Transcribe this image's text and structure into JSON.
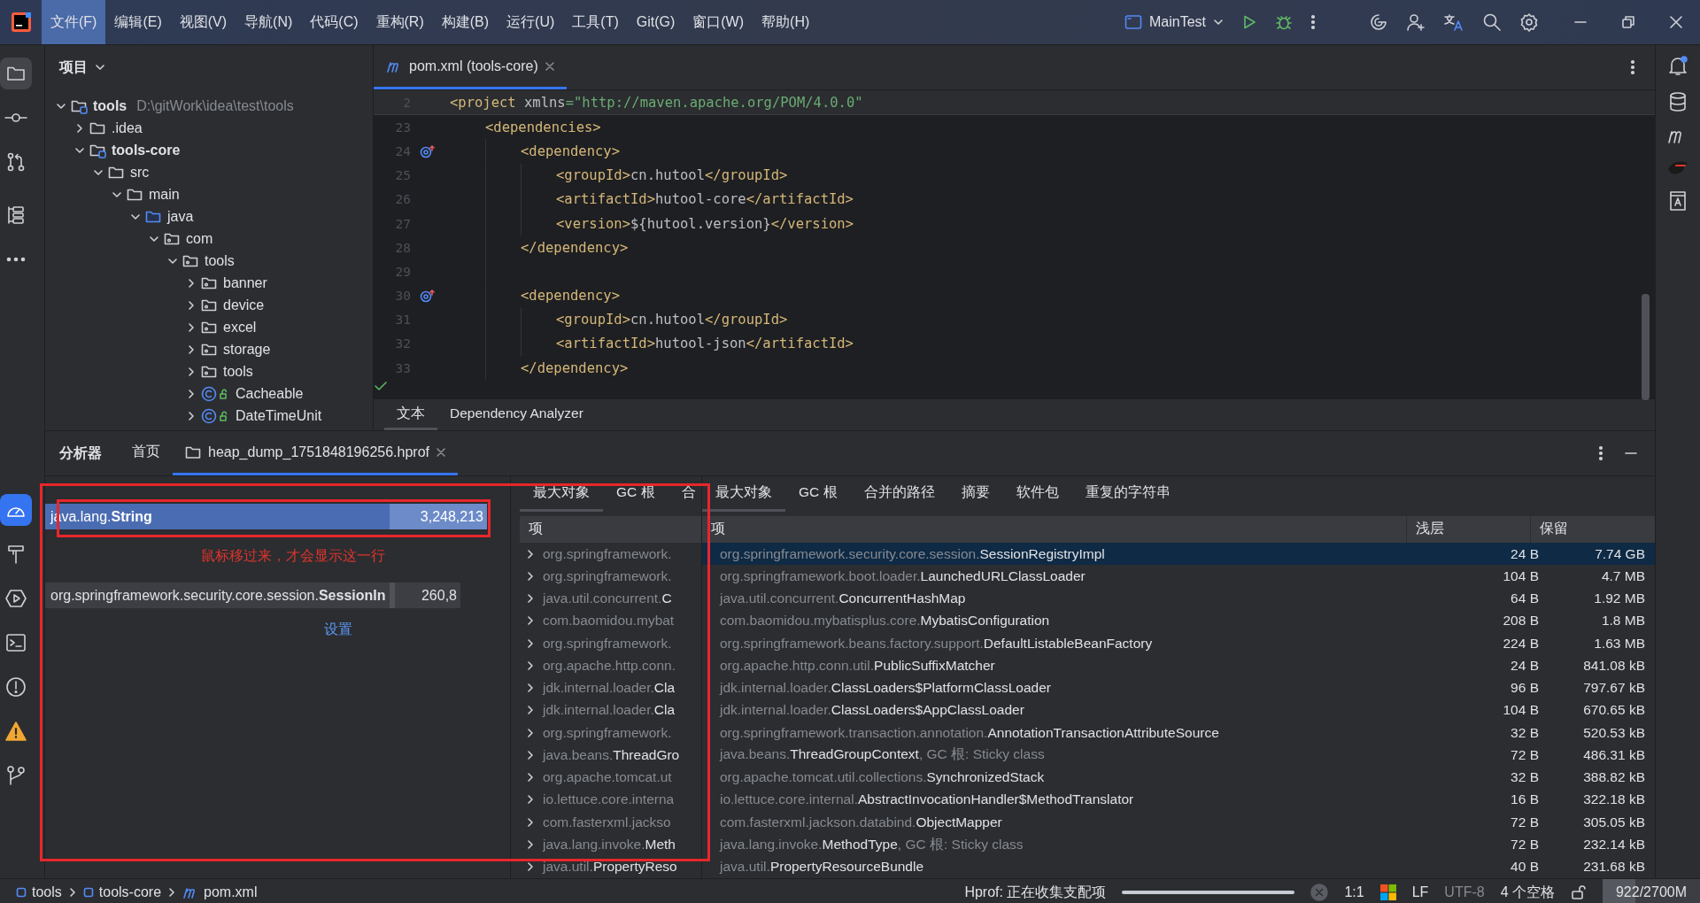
{
  "menu": [
    {
      "label": "文件(F)",
      "selected": true
    },
    {
      "label": "编辑(E)",
      "selected": false
    },
    {
      "label": "视图(V)",
      "selected": false
    },
    {
      "label": "导航(N)",
      "selected": false
    },
    {
      "label": "代码(C)",
      "selected": false
    },
    {
      "label": "重构(R)",
      "selected": false
    },
    {
      "label": "构建(B)",
      "selected": false
    },
    {
      "label": "运行(U)",
      "selected": false
    },
    {
      "label": "工具(T)",
      "selected": false
    },
    {
      "label": "Git(G)",
      "selected": false
    },
    {
      "label": "窗口(W)",
      "selected": false
    },
    {
      "label": "帮助(H)",
      "selected": false
    }
  ],
  "run_config": {
    "label": "MainTest"
  },
  "project_panel": {
    "title": "项目",
    "tree": [
      {
        "label": "tools",
        "kind": "module",
        "path": "D:\\gitWork\\idea\\test\\tools",
        "expanded": true,
        "children": [
          {
            "label": ".idea",
            "kind": "folder",
            "expanded": false
          },
          {
            "label": "tools-core",
            "kind": "module",
            "expanded": true,
            "children": [
              {
                "label": "src",
                "kind": "folder",
                "expanded": true,
                "children": [
                  {
                    "label": "main",
                    "kind": "folder",
                    "expanded": true,
                    "children": [
                      {
                        "label": "java",
                        "kind": "source",
                        "expanded": true,
                        "children": [
                          {
                            "label": "com",
                            "kind": "package",
                            "expanded": true,
                            "children": [
                              {
                                "label": "tools",
                                "kind": "package",
                                "expanded": true,
                                "children": [
                                  {
                                    "label": "banner",
                                    "kind": "package",
                                    "expanded": false
                                  },
                                  {
                                    "label": "device",
                                    "kind": "package",
                                    "expanded": false
                                  },
                                  {
                                    "label": "excel",
                                    "kind": "package",
                                    "expanded": false
                                  },
                                  {
                                    "label": "storage",
                                    "kind": "package",
                                    "expanded": false
                                  },
                                  {
                                    "label": "tools",
                                    "kind": "package",
                                    "expanded": false
                                  },
                                  {
                                    "label": "Cacheable",
                                    "kind": "class",
                                    "expanded": false
                                  },
                                  {
                                    "label": "DateTimeUnit",
                                    "kind": "class",
                                    "expanded": false
                                  }
                                ]
                              }
                            ]
                          }
                        ]
                      }
                    ]
                  }
                ]
              }
            ]
          }
        ]
      }
    ]
  },
  "editor": {
    "tab": {
      "label": "pom.xml (tools-core)",
      "selected": true
    },
    "lines": [
      {
        "n": "2",
        "sticky": true,
        "marker": false,
        "segs": [
          {
            "kind": "tag",
            "text": "<project"
          },
          {
            "kind": "text",
            "text": " xmlns"
          },
          {
            "kind": "string",
            "text": "=\"http://maven.apache.org/POM/4.0.0\""
          }
        ],
        "children": [
          {
            "n": "23",
            "sticky": false,
            "marker": false,
            "segs": [
              {
                "kind": "tag",
                "text": "<dependencies>"
              }
            ],
            "children": [
              {
                "n": "24",
                "sticky": false,
                "marker": true,
                "segs": [
                  {
                    "kind": "tag",
                    "text": "<dependency>"
                  }
                ],
                "children": [
                  {
                    "n": "25",
                    "sticky": false,
                    "marker": false,
                    "segs": [
                      {
                        "kind": "tag",
                        "text": "<groupId>"
                      },
                      {
                        "kind": "text",
                        "text": "cn.hutool"
                      },
                      {
                        "kind": "tag",
                        "text": "</groupId>"
                      }
                    ]
                  },
                  {
                    "n": "26",
                    "sticky": false,
                    "marker": false,
                    "segs": [
                      {
                        "kind": "tag",
                        "text": "<artifactId>"
                      },
                      {
                        "kind": "text",
                        "text": "hutool-core"
                      },
                      {
                        "kind": "tag",
                        "text": "</artifactId>"
                      }
                    ]
                  },
                  {
                    "n": "27",
                    "sticky": false,
                    "marker": false,
                    "segs": [
                      {
                        "kind": "tag",
                        "text": "<version>"
                      },
                      {
                        "kind": "text",
                        "text": "${hutool.version}"
                      },
                      {
                        "kind": "tag",
                        "text": "</version>"
                      }
                    ]
                  }
                ]
              },
              {
                "n": "28",
                "sticky": false,
                "marker": false,
                "segs": [
                  {
                    "kind": "tag",
                    "text": "</dependency>"
                  }
                ]
              },
              {
                "n": "29",
                "sticky": false,
                "marker": false
              },
              {
                "n": "30",
                "sticky": false,
                "marker": true,
                "segs": [
                  {
                    "kind": "tag",
                    "text": "<dependency>"
                  }
                ],
                "children": [
                  {
                    "n": "31",
                    "sticky": false,
                    "marker": false,
                    "segs": [
                      {
                        "kind": "tag",
                        "text": "<groupId>"
                      },
                      {
                        "kind": "text",
                        "text": "cn.hutool"
                      },
                      {
                        "kind": "tag",
                        "text": "</groupId>"
                      }
                    ]
                  },
                  {
                    "n": "32",
                    "sticky": false,
                    "marker": false,
                    "segs": [
                      {
                        "kind": "tag",
                        "text": "<artifactId>"
                      },
                      {
                        "kind": "text",
                        "text": "hutool-json"
                      },
                      {
                        "kind": "tag",
                        "text": "</artifactId>"
                      }
                    ]
                  }
                ]
              },
              {
                "n": "33",
                "sticky": false,
                "marker": false,
                "segs": [
                  {
                    "kind": "tag",
                    "text": "</dependency>"
                  }
                ]
              }
            ]
          }
        ]
      }
    ],
    "view_tabs": [
      {
        "label": "文本",
        "selected": true
      },
      {
        "label": "Dependency Analyzer",
        "selected": false
      }
    ]
  },
  "bottom_panel": {
    "title": "分析器",
    "tabs": [
      {
        "label": "首页",
        "kind": "plain",
        "selected": false
      },
      {
        "label": "heap_dump_1751848196256.hprof",
        "kind": "file",
        "selected": true
      }
    ],
    "flame": {
      "rows": [
        {
          "pkg": "java.lang.",
          "cls": "String",
          "count": "3,248,213",
          "hovered": true
        },
        {
          "pkg": "org.springframework.security.core.session.",
          "cls": "SessionIn",
          "count": "260,8",
          "hovered": false
        }
      ],
      "note": "鼠标移过来，才会显示这一行",
      "link": "设置"
    },
    "mini_table": {
      "tabs": [
        {
          "label": "最大对象",
          "selected": true
        },
        {
          "label": "GC 根",
          "selected": false
        },
        {
          "label": "合",
          "selected": false
        }
      ],
      "column": "项",
      "rows": [
        {
          "pkg": "org.springframework."
        },
        {
          "pkg": "org.springframework."
        },
        {
          "pkg": "java.util.concurrent.",
          "cls": "C"
        },
        {
          "pkg": "com.baomidou.mybat"
        },
        {
          "pkg": "org.springframework."
        },
        {
          "pkg": "org.apache.http.conn."
        },
        {
          "pkg": "jdk.internal.loader.",
          "cls": "Cla"
        },
        {
          "pkg": "jdk.internal.loader.",
          "cls": "Cla"
        },
        {
          "pkg": "org.springframework."
        },
        {
          "pkg": "java.beans.",
          "cls": "ThreadGro"
        },
        {
          "pkg": "org.apache.tomcat.ut"
        },
        {
          "pkg": "io.lettuce.core.interna"
        },
        {
          "pkg": "com.fasterxml.jackso"
        },
        {
          "pkg": "java.lang.invoke.",
          "cls": "Meth"
        },
        {
          "pkg": "java.util.",
          "cls": "PropertyReso"
        }
      ]
    },
    "table": {
      "tabs": [
        {
          "label": "最大对象",
          "selected": true
        },
        {
          "label": "GC 根",
          "selected": false
        },
        {
          "label": "合并的路径",
          "selected": false
        },
        {
          "label": "摘要",
          "selected": false
        },
        {
          "label": "软件包",
          "selected": false
        },
        {
          "label": "重复的字符串",
          "selected": false
        }
      ],
      "columns": [
        "项",
        "浅层",
        "保留"
      ],
      "rows": [
        {
          "pkg": "org.springframework.security.core.session.",
          "cls": "SessionRegistryImpl",
          "shallow": "24 B",
          "retained": "7.74 GB",
          "selected": true
        },
        {
          "pkg": "org.springframework.boot.loader.",
          "cls": "LaunchedURLClassLoader",
          "shallow": "104 B",
          "retained": "4.7 MB",
          "selected": false
        },
        {
          "pkg": "java.util.concurrent.",
          "cls": "ConcurrentHashMap",
          "shallow": "64 B",
          "retained": "1.92 MB",
          "selected": false
        },
        {
          "pkg": "com.baomidou.mybatisplus.core.",
          "cls": "MybatisConfiguration",
          "shallow": "208 B",
          "retained": "1.8 MB",
          "selected": false
        },
        {
          "pkg": "org.springframework.beans.factory.support.",
          "cls": "DefaultListableBeanFactory",
          "shallow": "224 B",
          "retained": "1.63 MB",
          "selected": false
        },
        {
          "pkg": "org.apache.http.conn.util.",
          "cls": "PublicSuffixMatcher",
          "shallow": "24 B",
          "retained": "841.08 kB",
          "selected": false
        },
        {
          "pkg": "jdk.internal.loader.",
          "cls": "ClassLoaders$PlatformClassLoader",
          "shallow": "96 B",
          "retained": "797.67 kB",
          "selected": false
        },
        {
          "pkg": "jdk.internal.loader.",
          "cls": "ClassLoaders$AppClassLoader",
          "shallow": "104 B",
          "retained": "670.65 kB",
          "selected": false
        },
        {
          "pkg": "org.springframework.transaction.annotation.",
          "cls": "AnnotationTransactionAttributeSource",
          "shallow": "32 B",
          "retained": "520.53 kB",
          "selected": false
        },
        {
          "pkg": "java.beans.",
          "cls": "ThreadGroupContext",
          "note": ", GC 根: Sticky class",
          "shallow": "72 B",
          "retained": "486.31 kB",
          "selected": false
        },
        {
          "pkg": "org.apache.tomcat.util.collections.",
          "cls": "SynchronizedStack",
          "shallow": "32 B",
          "retained": "388.82 kB",
          "selected": false
        },
        {
          "pkg": "io.lettuce.core.internal.",
          "cls": "AbstractInvocationHandler$MethodTranslator",
          "shallow": "16 B",
          "retained": "322.18 kB",
          "selected": false
        },
        {
          "pkg": "com.fasterxml.jackson.databind.",
          "cls": "ObjectMapper",
          "shallow": "72 B",
          "retained": "305.05 kB",
          "selected": false
        },
        {
          "pkg": "java.lang.invoke.",
          "cls": "MethodType",
          "note": ", GC 根: Sticky class",
          "shallow": "72 B",
          "retained": "232.14 kB",
          "selected": false
        },
        {
          "pkg": "java.util.",
          "cls": "PropertyResourceBundle",
          "shallow": "40 B",
          "retained": "231.68 kB",
          "selected": false
        }
      ]
    }
  },
  "status_bar": {
    "breadcrumbs": [
      {
        "label": "tools",
        "kind": "module"
      },
      {
        "label": "tools-core",
        "kind": "module"
      },
      {
        "label": "pom.xml",
        "kind": "maven"
      }
    ],
    "task": "Hprof: 正在收集支配项",
    "progress": {
      "level": 1
    },
    "position": "1:1",
    "line_separator": "LF",
    "encoding": "UTF-8",
    "indent": "4 个空格",
    "memory": {
      "label": "922/2700M",
      "level": 0.34
    }
  }
}
